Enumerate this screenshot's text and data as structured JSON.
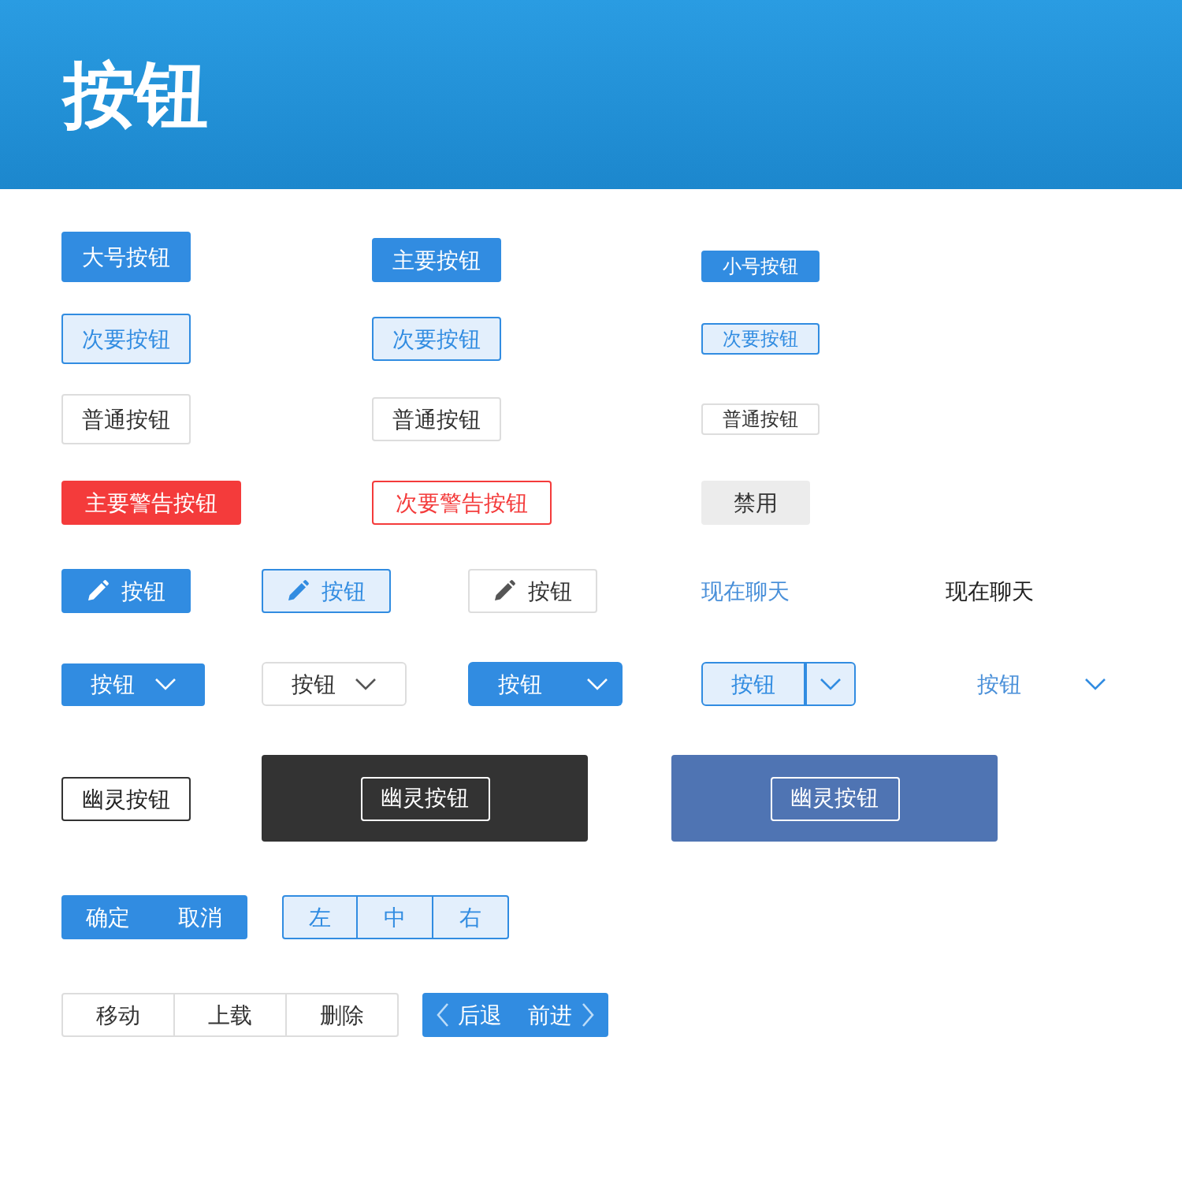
{
  "header": {
    "title": "按钮"
  },
  "rows": [
    {
      "items": [
        {
          "label": "大号按钮"
        },
        {
          "label": "主要按钮"
        },
        {
          "label": "小号按钮"
        }
      ]
    },
    {
      "items": [
        {
          "label": "次要按钮"
        },
        {
          "label": "次要按钮"
        },
        {
          "label": "次要按钮"
        }
      ]
    },
    {
      "items": [
        {
          "label": "普通按钮"
        },
        {
          "label": "普通按钮"
        },
        {
          "label": "普通按钮"
        }
      ]
    },
    {
      "items": [
        {
          "label": "主要警告按钮"
        },
        {
          "label": "次要警告按钮"
        },
        {
          "label": "禁用"
        }
      ]
    },
    {
      "items": [
        {
          "label": "按钮"
        },
        {
          "label": "按钮"
        },
        {
          "label": "按钮"
        },
        {
          "label": "现在聊天"
        },
        {
          "label": "现在聊天"
        }
      ]
    },
    {
      "items": [
        {
          "label": "按钮"
        },
        {
          "label": "按钮"
        },
        {
          "label": "按钮"
        },
        {
          "label": "按钮"
        },
        {
          "label": "按钮"
        }
      ]
    },
    {
      "items": [
        {
          "label": "幽灵按钮"
        },
        {
          "label": "幽灵按钮"
        },
        {
          "label": "幽灵按钮"
        }
      ]
    },
    {
      "items": [
        {
          "buttons": [
            {
              "label": "确定"
            },
            {
              "label": "取消"
            }
          ]
        },
        {
          "buttons": [
            {
              "label": "左"
            },
            {
              "label": "中"
            },
            {
              "label": "右"
            }
          ]
        }
      ]
    },
    {
      "items": [
        {
          "buttons": [
            {
              "label": "移动"
            },
            {
              "label": "上载"
            },
            {
              "label": "删除"
            }
          ]
        },
        {
          "buttons": [
            {
              "label": "后退"
            },
            {
              "label": "前进"
            }
          ]
        }
      ]
    }
  ]
}
